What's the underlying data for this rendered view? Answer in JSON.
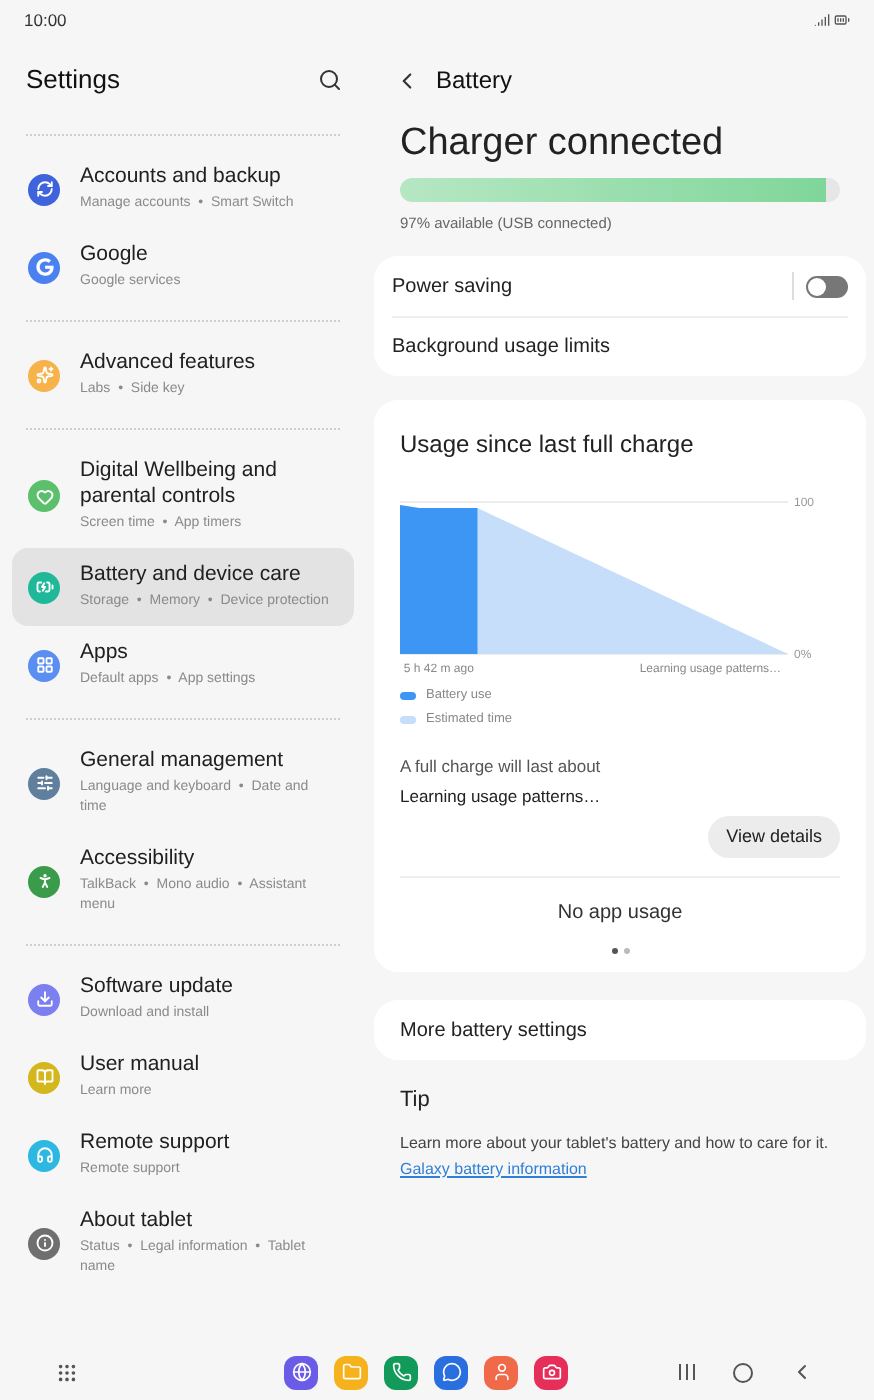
{
  "status_bar": {
    "time": "10:00"
  },
  "sidebar": {
    "title": "Settings",
    "groups": [
      [
        {
          "title": "Accounts and backup",
          "subtitle": "Manage accounts  •  Smart Switch",
          "color": "#3e63dd",
          "selected": false
        },
        {
          "title": "Google",
          "subtitle": "Google services",
          "color": "#4a80f0",
          "selected": false
        }
      ],
      [
        {
          "title": "Advanced features",
          "subtitle": "Labs  •  Side key",
          "color": "#f7b24a",
          "selected": false
        }
      ],
      [
        {
          "title": "Digital Wellbeing and parental controls",
          "subtitle": "Screen time  •  App timers",
          "color": "#5cbf6b",
          "selected": false
        },
        {
          "title": "Battery and device care",
          "subtitle": "Storage  •  Memory  •  Device protection",
          "color": "#1fb99a",
          "selected": true
        },
        {
          "title": "Apps",
          "subtitle": "Default apps  •  App settings",
          "color": "#5a8ef0",
          "selected": false
        }
      ],
      [
        {
          "title": "General management",
          "subtitle": "Language and keyboard  •  Date and time",
          "color": "#5f7f9c",
          "selected": false
        },
        {
          "title": "Accessibility",
          "subtitle": "TalkBack  •  Mono audio  •  Assistant menu",
          "color": "#3a9b4a",
          "selected": false
        }
      ],
      [
        {
          "title": "Software update",
          "subtitle": "Download and install",
          "color": "#7b7ff0",
          "selected": false
        },
        {
          "title": "User manual",
          "subtitle": "Learn more",
          "color": "#d4b71c",
          "selected": false
        },
        {
          "title": "Remote support",
          "subtitle": "Remote support",
          "color": "#2cb8e0",
          "selected": false
        },
        {
          "title": "About tablet",
          "subtitle": "Status  •  Legal information  •  Tablet name",
          "color": "#6f6f6f",
          "selected": false
        }
      ]
    ]
  },
  "battery": {
    "title": "Battery",
    "status": "Charger connected",
    "level": 0.97,
    "available": "97% available (USB connected)",
    "settings": [
      {
        "kind": "toggle",
        "label": "Power saving",
        "on": false
      },
      {
        "kind": "link",
        "label": "Background usage limits"
      }
    ],
    "usage": {
      "title": "Usage since last full charge",
      "chart_data": {
        "type": "area",
        "categories": [
          null,
          null,
          "5 h 42 m ago",
          null,
          null,
          null,
          null,
          null,
          null,
          null,
          null,
          null,
          null,
          null,
          null,
          null,
          "Learning usage patterns…",
          null,
          null,
          null,
          null
        ],
        "series": [
          {
            "name": "Battery use",
            "color": "#3e96f4",
            "values": [
              98,
              96,
              96,
              96,
              96,
              null,
              null,
              null,
              null,
              null,
              null,
              null,
              null,
              null,
              null,
              null,
              null,
              null,
              null,
              null,
              null
            ]
          },
          {
            "name": "Estimated time",
            "color": "#c6def9",
            "values": [
              null,
              null,
              null,
              null,
              96,
              90,
              84,
              78,
              72,
              66,
              60,
              54,
              48,
              42,
              36,
              30,
              24,
              18,
              12,
              6,
              0
            ]
          }
        ],
        "legend": true,
        "ylim": [
          0,
          100
        ],
        "yticks": [
          {
            "value": 100,
            "label": "100"
          },
          {
            "value": 0,
            "label": "0%"
          }
        ]
      },
      "estimate_label": "A full charge will last about",
      "estimate_value": "Learning usage patterns…",
      "button": "View details",
      "app_usage": "No app usage",
      "pages": [
        {
          "selected": true
        },
        {
          "selected": false
        }
      ]
    },
    "more": "More battery settings",
    "tip": {
      "title": "Tip",
      "text": "Learn more about your tablet's battery and how to care for it.",
      "link": "Galaxy battery information"
    }
  }
}
